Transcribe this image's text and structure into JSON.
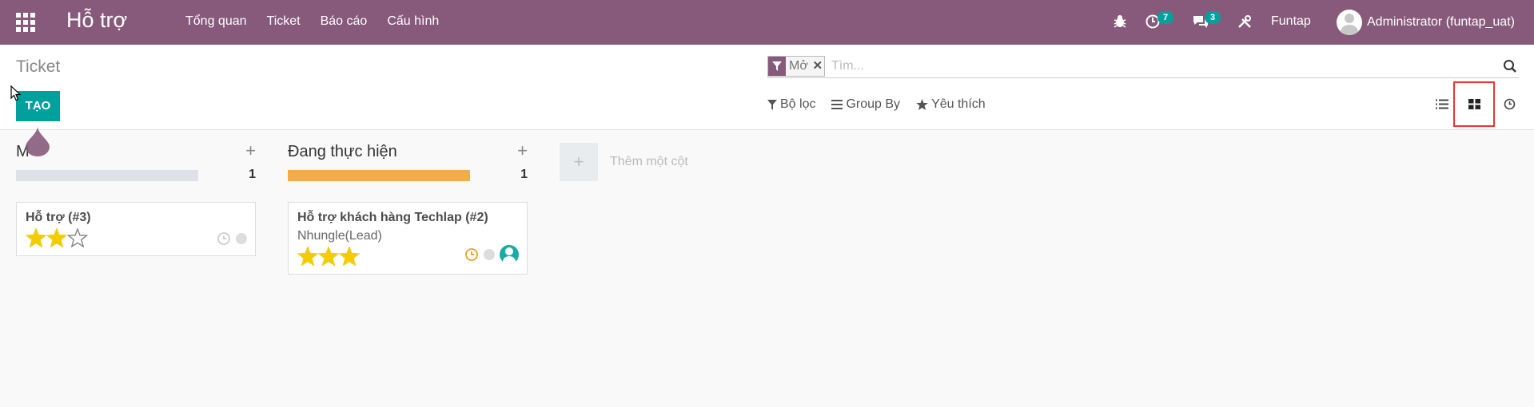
{
  "navbar": {
    "apps_icon": "grid-icon",
    "brand": "Hỗ trợ",
    "menu": [
      "Tổng quan",
      "Ticket",
      "Báo cáo",
      "Cấu hình"
    ],
    "activity_count": "7",
    "messages_count": "3",
    "company": "Funtap",
    "user": "Administrator (funtap_uat)"
  },
  "control": {
    "breadcrumb": "Ticket",
    "create_label": "TẠO",
    "facet_value": "Mở",
    "search_placeholder": "Tìm...",
    "filters_label": "Bộ lọc",
    "groupby_label": "Group By",
    "favorites_label": "Yêu thích"
  },
  "kanban": {
    "columns": [
      {
        "title": "M",
        "count": "1",
        "progress_color": "#dee2e6",
        "progress_fraction": 1.0,
        "cards": [
          {
            "title": "Hỗ trợ (#3)",
            "subtitle": "",
            "stars": 2,
            "max_stars": 3,
            "activity_color": "#ccc"
          }
        ]
      },
      {
        "title": "Đang thực hiện",
        "count": "1",
        "progress_color": "#f0ad4e",
        "progress_fraction": 1.0,
        "cards": [
          {
            "title": "Hỗ trợ khách hàng Techlap (#2)",
            "subtitle": "Nhungle(Lead)",
            "stars": 3,
            "max_stars": 3,
            "activity_color": "#f0a020"
          }
        ]
      }
    ],
    "add_column_label": "Thêm một cột"
  },
  "colors": {
    "navbar": "#875a7b",
    "primary": "#00a09d",
    "star": "#f3cc00",
    "highlight_box": "#e33"
  }
}
